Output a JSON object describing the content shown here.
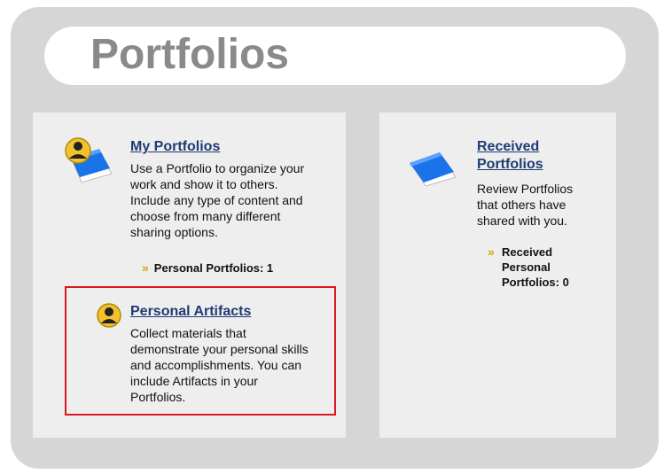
{
  "page": {
    "title": "Portfolios"
  },
  "my_portfolios": {
    "title": "My Portfolios",
    "description_lines": [
      "Use a Portfolio to organize your",
      "work and show it to others.",
      "Include any type of content and",
      "choose from many different",
      "sharing options."
    ],
    "stat": "Personal Portfolios: 1"
  },
  "personal_artifacts": {
    "title": "Personal Artifacts",
    "description_lines": [
      "Collect materials that",
      "demonstrate your personal skills",
      "and accomplishments. You can",
      "include Artifacts in your",
      "Portfolios."
    ]
  },
  "received_portfolios": {
    "title_lines": [
      "Received",
      "Portfolios"
    ],
    "description_lines": [
      "Review Portfolios",
      "that others have",
      "shared with you."
    ],
    "stat_lines": [
      "Received",
      "Personal",
      "Portfolios: 0"
    ]
  },
  "colors": {
    "link": "#1f3b73",
    "highlight_border": "#d8191f",
    "chevron": "#e0a000",
    "panel_bg": "#eeeeee",
    "outer_bg": "#d6d6d6",
    "title_gray": "#8a8a8a"
  },
  "icons": {
    "my_portfolios": "user-portfolio-icon",
    "personal_artifacts": "user-avatar-icon",
    "received_portfolios": "portfolio-folder-icon",
    "stat_bullet": "double-chevron-right-icon"
  }
}
